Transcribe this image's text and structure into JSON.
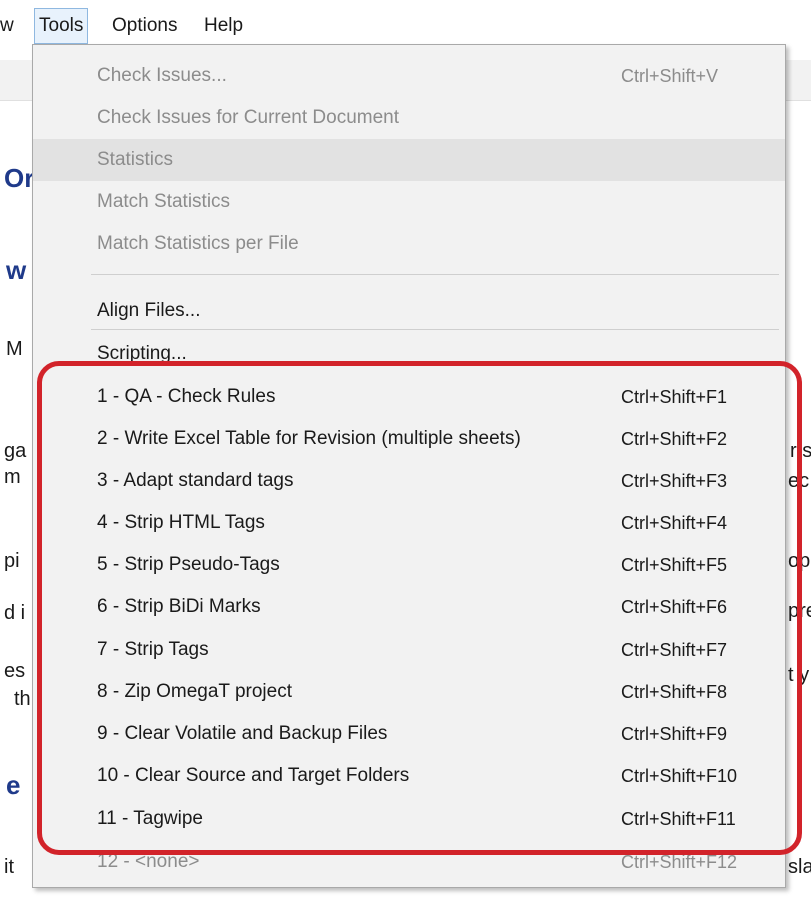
{
  "menubar": {
    "items": [
      {
        "label": "w"
      },
      {
        "label": "Tools"
      },
      {
        "label": "Options"
      },
      {
        "label": "Help"
      }
    ]
  },
  "background": {
    "left_fragments": [
      "Or",
      "w",
      "M",
      "ga",
      "m",
      "pi",
      "d i",
      "es",
      "th",
      "e",
      "it"
    ],
    "right_fragments": [
      "r s",
      "ec",
      "op",
      "pre",
      "t y",
      "sla"
    ]
  },
  "menu": {
    "top_items": [
      {
        "label": "Check Issues...",
        "shortcut": "Ctrl+Shift+V",
        "disabled": true
      },
      {
        "label": "Check Issues for Current Document",
        "shortcut": "",
        "disabled": true
      },
      {
        "label": "Statistics",
        "shortcut": "",
        "disabled": true
      },
      {
        "label": "Match Statistics",
        "shortcut": "",
        "disabled": true
      },
      {
        "label": "Match Statistics per File",
        "shortcut": "",
        "disabled": true
      }
    ],
    "align_item": {
      "label": "Align Files...",
      "shortcut": ""
    },
    "scripting_item": {
      "label": "Scripting...",
      "shortcut": ""
    },
    "script_items": [
      {
        "label": "1 - QA - Check Rules",
        "shortcut": "Ctrl+Shift+F1"
      },
      {
        "label": "2 - Write Excel Table for Revision (multiple sheets)",
        "shortcut": "Ctrl+Shift+F2"
      },
      {
        "label": "3 - Adapt standard tags",
        "shortcut": "Ctrl+Shift+F3"
      },
      {
        "label": "4 - Strip HTML Tags",
        "shortcut": "Ctrl+Shift+F4"
      },
      {
        "label": "5 - Strip Pseudo-Tags",
        "shortcut": "Ctrl+Shift+F5"
      },
      {
        "label": "6 - Strip BiDi Marks",
        "shortcut": "Ctrl+Shift+F6"
      },
      {
        "label": "7 - Strip Tags",
        "shortcut": "Ctrl+Shift+F7"
      },
      {
        "label": "8 - Zip OmegaT project",
        "shortcut": "Ctrl+Shift+F8"
      },
      {
        "label": "9 - Clear Volatile and Backup Files",
        "shortcut": "Ctrl+Shift+F9"
      },
      {
        "label": "10 - Clear Source and Target Folders",
        "shortcut": "Ctrl+Shift+F10"
      },
      {
        "label": "11 - Tagwipe",
        "shortcut": "Ctrl+Shift+F11"
      }
    ],
    "last_item": {
      "label": "12 - <none>",
      "shortcut": "Ctrl+Shift+F12",
      "disabled": true
    }
  },
  "colors": {
    "highlight_border": "#d2232a",
    "menu_bg": "#f2f2f2",
    "disabled_text": "#8c8c8c"
  }
}
